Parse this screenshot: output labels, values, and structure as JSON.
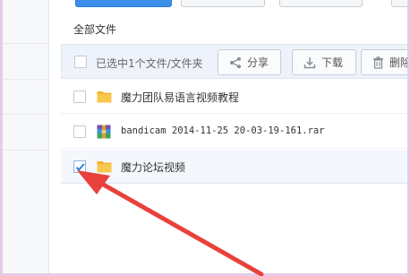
{
  "breadcrumb": "全部文件",
  "toolbar": {
    "selection_text": "已选中1个文件/文件夹",
    "share_label": "分享",
    "download_label": "下载",
    "delete_label": "删除"
  },
  "files": [
    {
      "name": "魔力团队易语言视频教程",
      "type": "folder",
      "checked": false
    },
    {
      "name": "bandicam 2014-11-25 20-03-19-161.rar",
      "type": "rar",
      "checked": false
    },
    {
      "name": "魔力论坛视频",
      "type": "folder",
      "checked": true
    }
  ],
  "colors": {
    "accent": "#3c8ee8",
    "folder": "#f5c443",
    "annotation_arrow": "#e8413b",
    "frame_border": "#e6cce6"
  },
  "icons": {
    "share": "share-icon",
    "download": "download-icon",
    "delete": "trash-icon",
    "folder": "folder-icon",
    "archive": "rar-archive-icon",
    "check": "checkmark-icon"
  }
}
